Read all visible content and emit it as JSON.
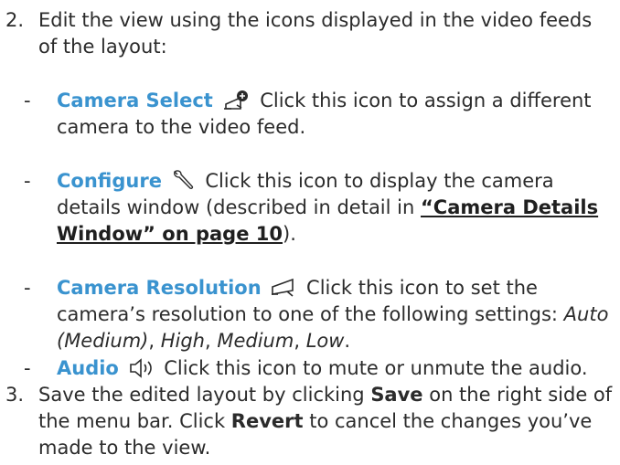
{
  "step2": {
    "number": "2.",
    "text": "Edit the view using the icons displayed in the video feeds of the layout:"
  },
  "items": [
    {
      "dash": "-",
      "term": "Camera Select",
      "icon": "camera-select-icon",
      "text": "Click this icon to assign a different camera to the video feed."
    },
    {
      "dash": "-",
      "term": "Configure",
      "icon": "wrench-icon",
      "text_before": "Click this icon to display the camera details window (described in detail in ",
      "link": "“Camera Details Window” on page 10",
      "text_after": ")."
    },
    {
      "dash": "-",
      "term": "Camera Resolution",
      "icon": "camera-icon",
      "text": "Click this icon to set the camera’s resolution to one of the following settings:",
      "options": [
        "Auto (Medium)",
        "High",
        "Medium",
        "Low"
      ],
      "sep": ", ",
      "end": "."
    },
    {
      "dash": "-",
      "term": "Audio",
      "icon": "speaker-icon",
      "text": "Click this icon to mute or unmute the audio."
    }
  ],
  "step3": {
    "number": "3.",
    "text_1": "Save the edited layout by clicking ",
    "save": "Save",
    "text_2": " on the right side of the menu bar. Click ",
    "revert": "Revert",
    "text_3": " to cancel the changes you’ve made to the view."
  },
  "colors": {
    "term": "#3a93cf",
    "text": "#2b2b2b"
  }
}
